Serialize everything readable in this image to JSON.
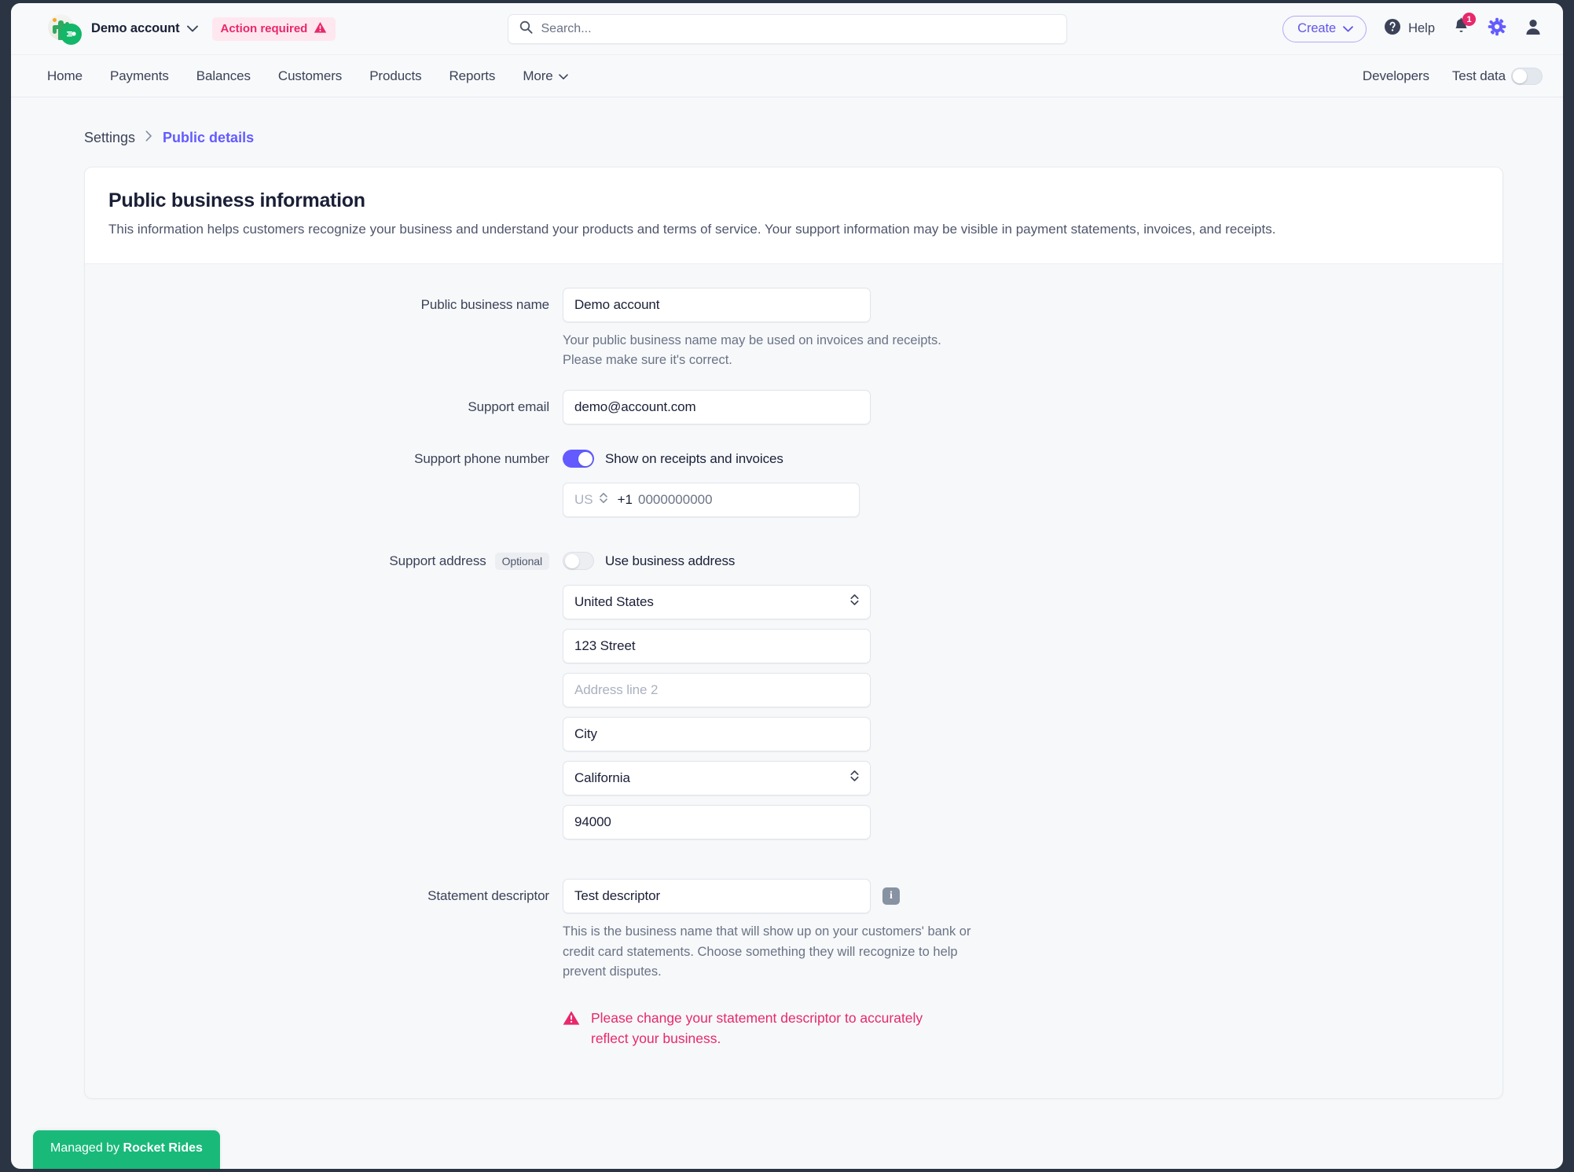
{
  "topbar": {
    "account_name": "Demo account",
    "account_badge": "Action required",
    "logo_icon": "cactus-avatar-icon",
    "search_placeholder": "Search...",
    "search_icon": "search-icon",
    "create_label": "Create",
    "help_label": "Help",
    "notification_count": "1",
    "settings_icon": "gear-icon",
    "profile_icon": "user-icon",
    "bell_icon": "bell-icon"
  },
  "nav": {
    "items": [
      {
        "label": "Home"
      },
      {
        "label": "Payments"
      },
      {
        "label": "Balances"
      },
      {
        "label": "Customers"
      },
      {
        "label": "Products"
      },
      {
        "label": "Reports"
      },
      {
        "label": "More"
      }
    ],
    "developers_label": "Developers",
    "test_data_label": "Test data",
    "test_data_on": false
  },
  "breadcrumb": {
    "parent": "Settings",
    "separator": "›",
    "current": "Public details"
  },
  "card": {
    "title": "Public business information",
    "subtitle": "This information helps customers recognize your business and understand your products and terms of service. Your support information may be visible in payment statements, invoices, and receipts."
  },
  "form": {
    "business_name": {
      "label": "Public business name",
      "value": "Demo account",
      "hint": "Your public business name may be used on invoices and receipts. Please make sure it's correct."
    },
    "support_email": {
      "label": "Support email",
      "value": "demo@account.com"
    },
    "support_phone": {
      "label": "Support phone number",
      "toggle_label": "Show on receipts and invoices",
      "toggle_on": true,
      "country_code": "US",
      "dial_prefix": "+1",
      "number_placeholder": "0000000000"
    },
    "support_address": {
      "label": "Support address",
      "optional_badge": "Optional",
      "toggle_label": "Use business address",
      "toggle_on": false,
      "country": "United States",
      "line1": "123 Street",
      "line2_placeholder": "Address line 2",
      "city": "City",
      "state": "California",
      "postal_code": "94000"
    },
    "statement_descriptor": {
      "label": "Statement descriptor",
      "value": "Test descriptor",
      "info_icon": "info-icon",
      "hint": "This is the business name that will show up on your customers' bank or credit card statements. Choose something they will recognize to help prevent disputes.",
      "error": "Please change your statement descriptor to accurately reflect your business."
    }
  },
  "footer": {
    "managed_prefix": "Managed by ",
    "managed_brand": "Rocket Rides"
  },
  "colors": {
    "accent": "#635bff",
    "danger": "#e8286b",
    "success": "#19b97a",
    "text": "#1a1f36"
  }
}
